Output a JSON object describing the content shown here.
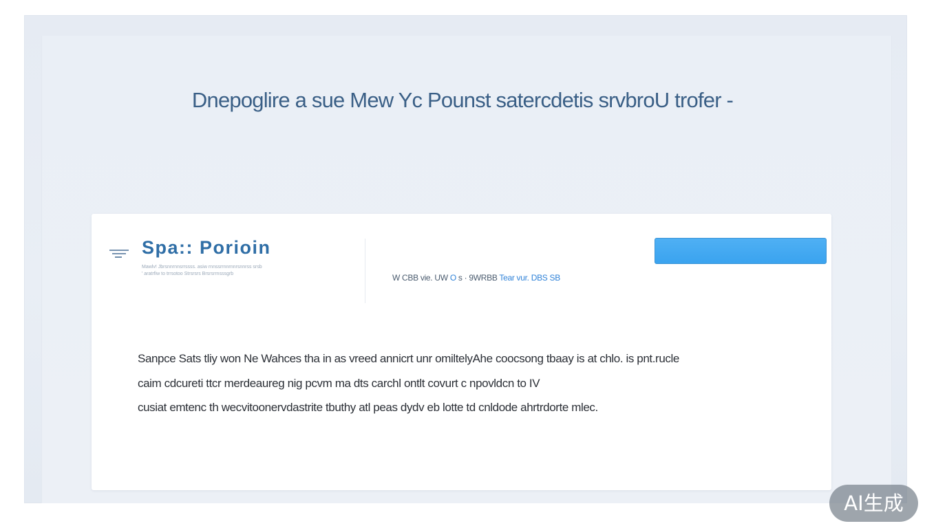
{
  "page": {
    "headline": "Dnepoglire a sue Mew Yc Pounst satercdetis srvbroU trofer -"
  },
  "header": {
    "menu_icon": "menu-icon",
    "brand_title": "Spa:: Porioin",
    "brand_subtitle_1": "Mawlv! Jbrsnnrnnsrrssss.    asiw  rnnssrrnnrnnrsnnrss srsb",
    "brand_subtitle_2": "' aratrfiw to trrsotoo Strsrsrs Brsrsrrnsssgrb",
    "meta_prefix": "W  CBB   vie.   UW",
    "meta_accent_1": "O ",
    "meta_mid": "s  ·  9WRBB ",
    "meta_accent_2": "Tear vur. DBS SB",
    "cta_label": ""
  },
  "content": {
    "lines": [
      "Sanpce Sats tliy won Ne Wahces tha in as vreed annicrt unr omiltelyAhe coocsong tbaay is at chlo. is pnt.rucle",
      "caim cdcureti ttcr merdeaureg nig pcvm ma dts carchl ontlt covurt c npovldcn to IV",
      "cusiat emtenc th wecvitoonervdastrite tbuthy atl peas dydv eb lotte td  cnldode  ahrtrdorte mlec."
    ]
  },
  "watermark": {
    "label": "AI生成"
  },
  "colors": {
    "accent": "#2f6ea6",
    "button": "#3aa3ef",
    "headline": "#3a5f86"
  }
}
